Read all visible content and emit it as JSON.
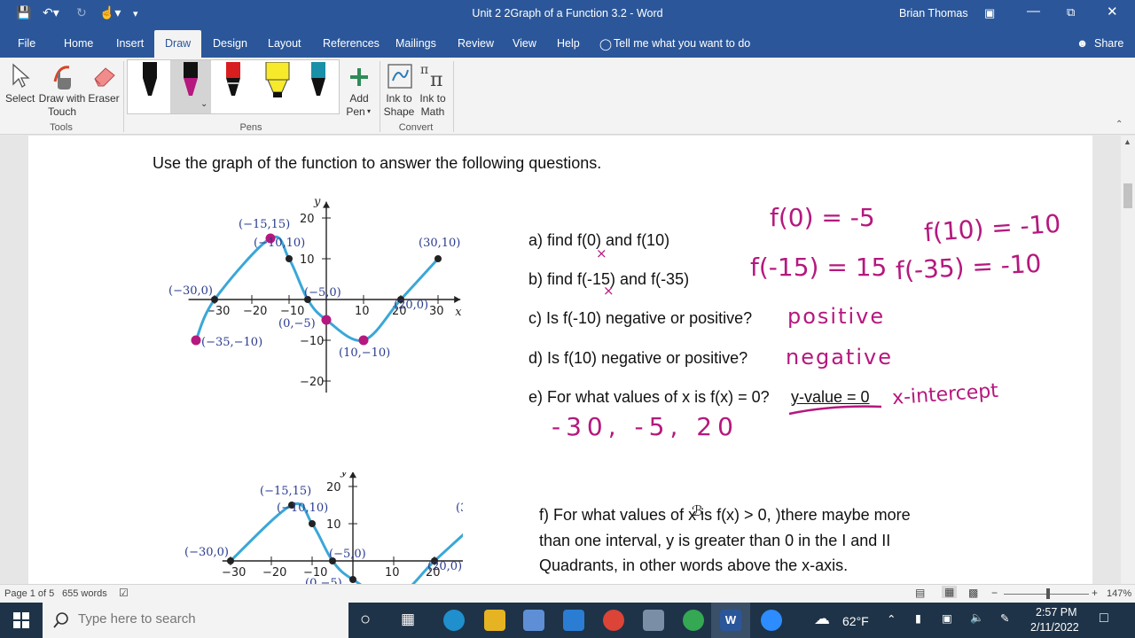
{
  "titlebar": {
    "doc_title": "Unit 2 2Graph of a Function 3.2  -  Word",
    "user": "Brian Thomas"
  },
  "tabs": [
    {
      "label": "File"
    },
    {
      "label": "Home"
    },
    {
      "label": "Insert"
    },
    {
      "label": "Draw"
    },
    {
      "label": "Design"
    },
    {
      "label": "Layout"
    },
    {
      "label": "References"
    },
    {
      "label": "Mailings"
    },
    {
      "label": "Review"
    },
    {
      "label": "View"
    },
    {
      "label": "Help"
    }
  ],
  "tell_me": "Tell me what you want to do",
  "share": "Share",
  "ribbon": {
    "select": "Select",
    "draw_touch_1": "Draw with",
    "draw_touch_2": "Touch",
    "eraser": "Eraser",
    "tools_group": "Tools",
    "pens_group": "Pens",
    "add_pen_1": "Add",
    "add_pen_2": "Pen",
    "ink_shape_1": "Ink to",
    "ink_shape_2": "Shape",
    "ink_math_1": "Ink to",
    "ink_math_2": "Math",
    "convert_group": "Convert",
    "pen_colors": [
      "#111111",
      "#b5187e",
      "#d81e1e",
      "#f7ea2a",
      "#1a8fa8"
    ]
  },
  "doc": {
    "intro": "Use the graph of the function to answer the following questions.",
    "qa": "a) find f(0) and f(10)",
    "qb": "b) find f(-15) and f(-35)",
    "qc": "c)  Is f(-10)  negative or positive?",
    "qd": "d) Is  f(10)  negative or positive?",
    "qe": "e) For what values of x is f(x) = 0?",
    "qe_note": "y-value = 0",
    "qf_1": "f)  For what values of x is f(x) > 0, )there maybe more",
    "qf_2": "than one interval, y is greater than 0 in the I and II",
    "qf_3": "Quadrants, in other words above the x-axis."
  },
  "ink": {
    "f0": "f(0) = -5",
    "f10": "f(10) = -10",
    "fm15": "f(-15) = 15",
    "fm35": "f(-35) = -10",
    "positive": "positive",
    "negative": "negative",
    "xint": "x-intercept",
    "zeros": "-30, -5, 20"
  },
  "graph": {
    "x_label": "x",
    "y_label": "y",
    "x_ticks": [
      "-30",
      "-20",
      "-10",
      "10",
      "20",
      "30"
    ],
    "y_ticks": [
      "20",
      "10",
      "-10",
      "-20"
    ],
    "points": [
      {
        "label": "(−15,15)",
        "x": -15,
        "y": 15
      },
      {
        "label": "(−10,10)",
        "x": -10,
        "y": 10
      },
      {
        "label": "(−30,0)",
        "x": -30,
        "y": 0
      },
      {
        "label": "(−5,0)",
        "x": -5,
        "y": 0
      },
      {
        "label": "(0,−5)",
        "x": 0,
        "y": -5
      },
      {
        "label": "(−35,−10)",
        "x": -35,
        "y": -10
      },
      {
        "label": "(10,−10)",
        "x": 10,
        "y": -10
      },
      {
        "label": "(20,0)",
        "x": 20,
        "y": 0
      },
      {
        "label": "(30,10)",
        "x": 30,
        "y": 10
      }
    ],
    "curve_color": "#3aa7d8",
    "label_color": "#2a3b8f"
  },
  "status": {
    "page": "Page 1 of 5",
    "words": "655 words",
    "zoom": "147%"
  },
  "taskbar": {
    "search_placeholder": "Type here to search",
    "temp": "62°F",
    "time": "2:57 PM",
    "date": "2/11/2022"
  }
}
